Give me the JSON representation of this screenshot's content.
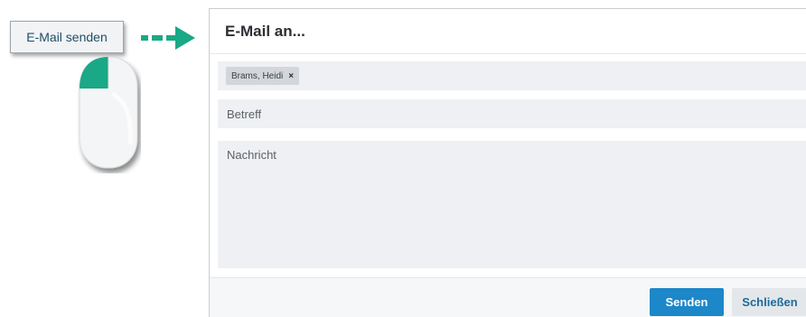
{
  "illustration": {
    "trigger_label": "E-Mail senden",
    "mouse_icon": "mouse-left-click-icon",
    "arrow_icon": "dashed-arrow-right-icon",
    "accent_color": "#1aa886"
  },
  "dialog": {
    "title": "E-Mail an...",
    "recipients": [
      {
        "name": "Brams, Heidi"
      }
    ],
    "chip_remove_glyph": "×",
    "subject_placeholder": "Betreff",
    "message_placeholder": "Nachricht",
    "send_label": "Senden",
    "close_label": "Schließen",
    "primary_color": "#1c87c9"
  }
}
